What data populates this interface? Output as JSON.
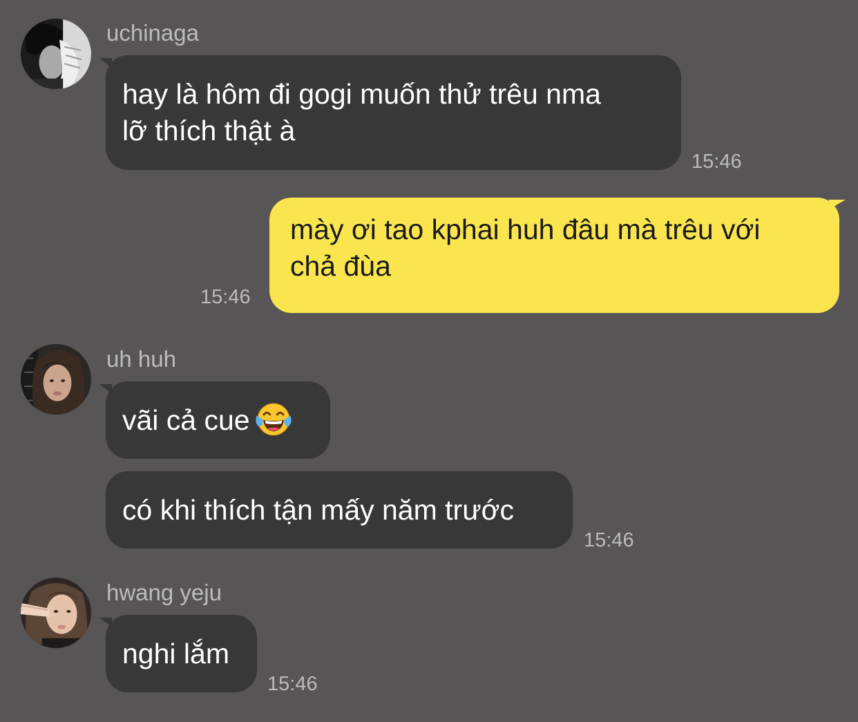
{
  "messages": [
    {
      "sender": "uchinaga",
      "lines": [
        "hay là hôm đi gogi muốn thử trêu nma",
        "lỡ thích thật à"
      ],
      "time": "15:46"
    },
    {
      "sender": "me",
      "lines": [
        "mày ơi tao kphai huh đâu mà trêu với",
        "chả đùa"
      ],
      "time": "15:46"
    },
    {
      "sender": "uh huh",
      "bubble1": "vãi cả cue",
      "emoji": "face-with-tears-of-joy-icon",
      "bubble2": "có khi thích tận mấy năm trước",
      "time": "15:46"
    },
    {
      "sender": "hwang yeju",
      "text": "nghi lắm",
      "time": "15:46"
    }
  ],
  "colors": {
    "background": "#575556",
    "incoming_bubble": "#383839",
    "outgoing_bubble": "#fae54f",
    "meta_text": "#bdbcbc"
  }
}
